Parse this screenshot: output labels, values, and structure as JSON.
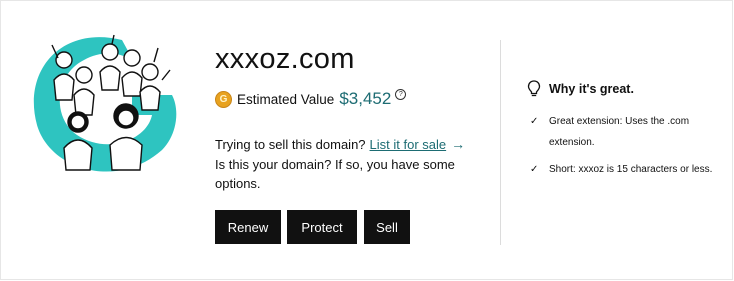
{
  "domain": {
    "name": "xxxoz.com"
  },
  "valuation": {
    "coin_letter": "G",
    "label": "Estimated Value",
    "amount": "$3,452",
    "info_symbol": "?"
  },
  "sell": {
    "prompt": "Trying to sell this domain?",
    "link_label": "List it for sale",
    "arrow": "→"
  },
  "ownership": {
    "text": "Is this your domain? If so, you have some options."
  },
  "buttons": {
    "renew": "Renew",
    "protect": "Protect",
    "sell": "Sell"
  },
  "why": {
    "title": "Why it's great.",
    "reasons": [
      {
        "check": "✓",
        "text": "Great extension: Uses the .com extension."
      },
      {
        "check": "✓",
        "text": "Short: xxxoz is 15 characters or less."
      }
    ]
  },
  "icons": {
    "illustration": "crowd-cheering-illustration",
    "why": "lightbulb-icon"
  },
  "colors": {
    "accent": "#1d6c73",
    "illustration_teal": "#2ec4c0",
    "coin": "#e8a21f",
    "button_bg": "#111111"
  }
}
